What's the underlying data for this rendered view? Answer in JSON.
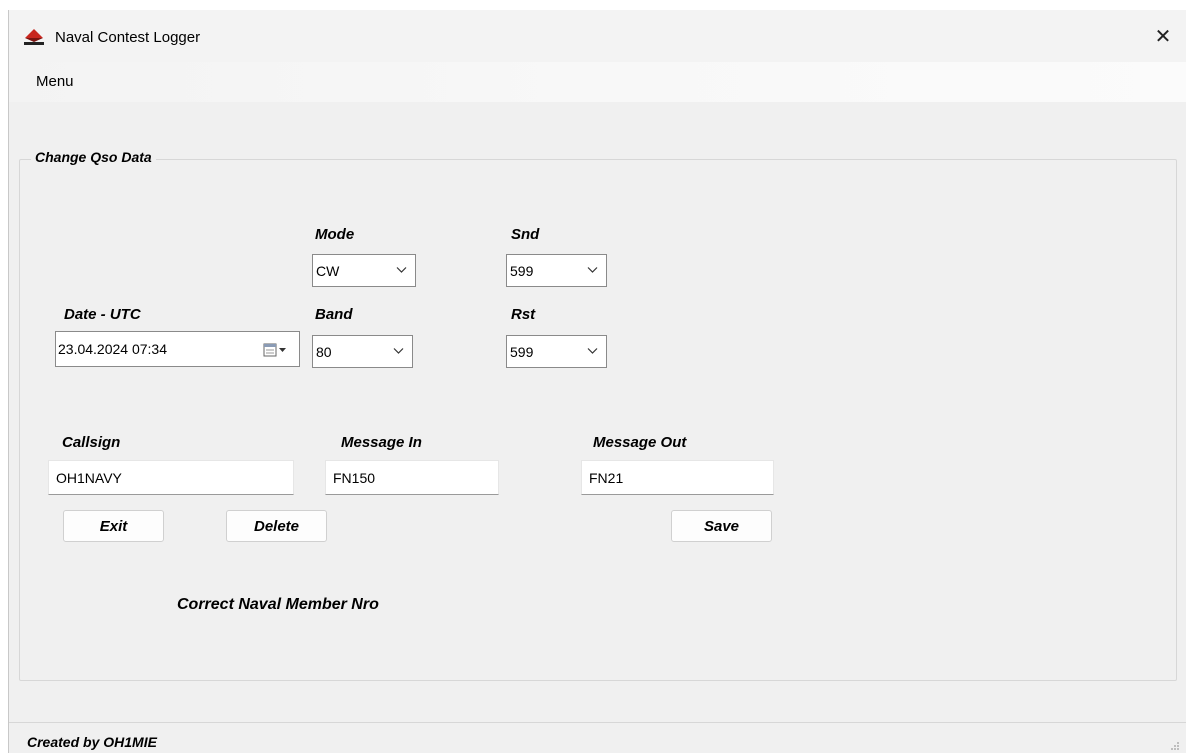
{
  "window": {
    "title": "Naval Contest Logger",
    "close_label": "✕"
  },
  "menu": {
    "label": "Menu"
  },
  "group": {
    "title": "Change Qso Data"
  },
  "fields": {
    "mode": {
      "label": "Mode",
      "value": "CW"
    },
    "snd": {
      "label": "Snd",
      "value": "599"
    },
    "band": {
      "label": "Band",
      "value": "80"
    },
    "rst": {
      "label": "Rst",
      "value": "599"
    },
    "date": {
      "label": "Date - UTC",
      "value": "23.04.2024 07:34"
    },
    "callsign": {
      "label": "Callsign",
      "value": "OH1NAVY"
    },
    "message_in": {
      "label": "Message In",
      "value": "FN150"
    },
    "message_out": {
      "label": "Message Out",
      "value": "FN21"
    }
  },
  "buttons": {
    "exit": "Exit",
    "delete": "Delete",
    "save": "Save"
  },
  "info": {
    "text": "Correct Naval Member Nro"
  },
  "status": {
    "text": "Created by OH1MIE"
  },
  "colors": {
    "window_bg": "#f0f0f0",
    "icon_red": "#c8261e",
    "border": "#8a8a8a"
  }
}
